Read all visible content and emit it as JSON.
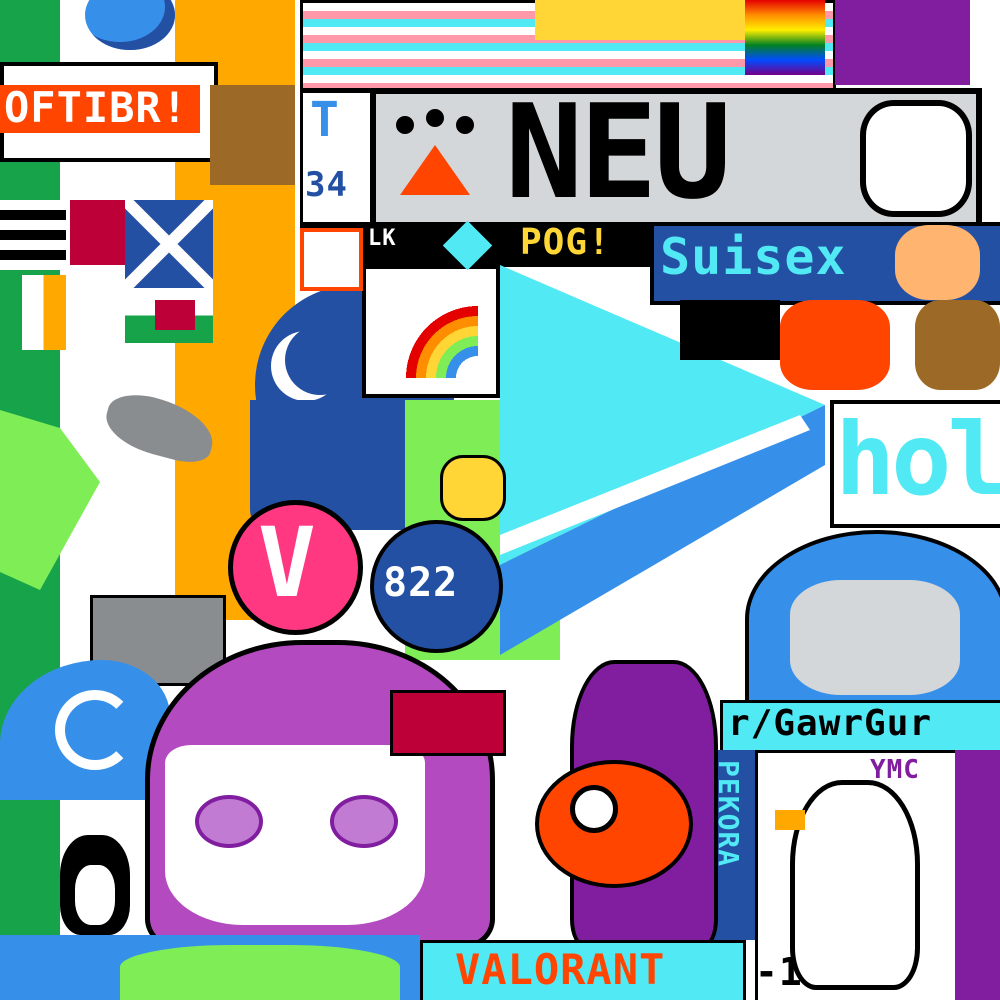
{
  "canvas": {
    "type": "pixel-art-canvas"
  },
  "texts": {
    "oft": "OFTIBR!",
    "neu": "NEU",
    "t_letter": "T",
    "t_number": "34",
    "lk": "LK",
    "pog": "POG!",
    "suisex": "Suisex",
    "holo": "hol",
    "gawr": "r/GawrGur",
    "pekora": "PEKORA",
    "valorant": "VALORANT",
    "ymc": "YMC",
    "v_badge": "V",
    "clock": "822",
    "minus_one": "-1"
  },
  "colors": {
    "ireland_green": "#16a34a",
    "orange": "#f59e0b",
    "neu_red": "#ff4500",
    "sky": "#51e9f4",
    "navy": "#2450a4",
    "purple": "#811e9f",
    "pink": "#ff99aa"
  }
}
